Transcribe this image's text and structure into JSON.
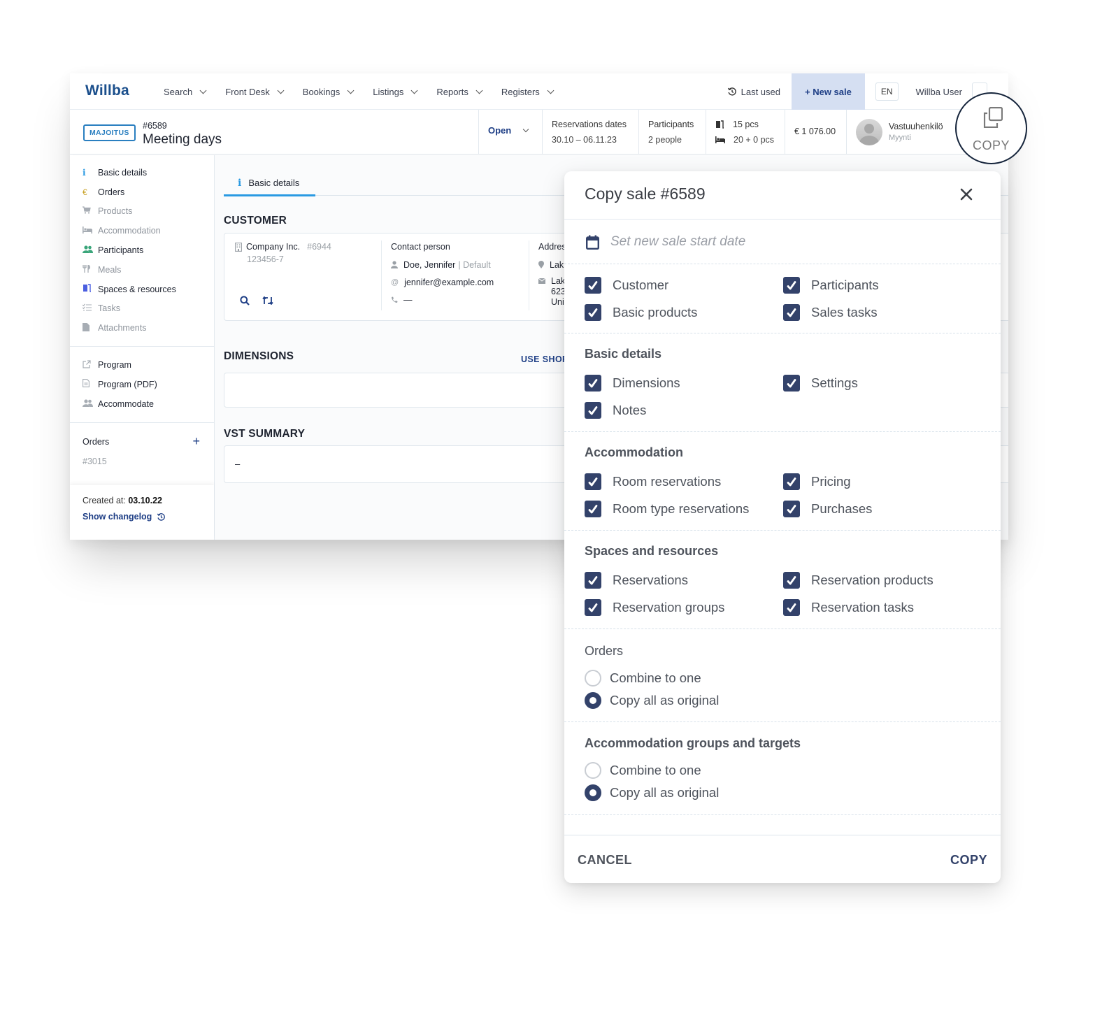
{
  "nav": {
    "logo": "Willba",
    "menu": [
      {
        "label": "Search"
      },
      {
        "label": "Front Desk"
      },
      {
        "label": "Bookings"
      },
      {
        "label": "Listings"
      },
      {
        "label": "Reports"
      },
      {
        "label": "Registers"
      }
    ],
    "last_used": "Last used",
    "new_sale": "+ New sale",
    "language": "EN",
    "user_name": "Willba User"
  },
  "sale": {
    "type_badge": "MAJOITUS",
    "id": "#6589",
    "title": "Meeting days",
    "status": "Open",
    "reservation_dates_label": "Reservations dates",
    "reservation_dates_value": "30.10 – 06.11.23",
    "participants_label": "Participants",
    "participants_value": "2 people",
    "spaces_count": "15 pcs",
    "beds_count": "20 + 0 pcs",
    "total": "€ 1 076.00",
    "responsible_name": "Vastuuhenkilö",
    "responsible_role": "Myynti"
  },
  "copy_callout": {
    "label": "COPY"
  },
  "sidebar": {
    "items": [
      {
        "label": "Basic details",
        "icon": "i",
        "state": "on",
        "color": "#2a9ae2"
      },
      {
        "label": "Orders",
        "icon": "€",
        "state": "on",
        "color": "#c9a227"
      },
      {
        "label": "Products",
        "icon": "cart",
        "state": "off",
        "color": "#a7adb4"
      },
      {
        "label": "Accommodation",
        "icon": "bed",
        "state": "off",
        "color": "#a7adb4"
      },
      {
        "label": "Participants",
        "icon": "people",
        "state": "on",
        "color": "#3aa57a"
      },
      {
        "label": "Meals",
        "icon": "cutlery",
        "state": "off",
        "color": "#a7adb4"
      },
      {
        "label": "Spaces & resources",
        "icon": "door",
        "state": "on",
        "color": "#4b5fe0"
      },
      {
        "label": "Tasks",
        "icon": "list",
        "state": "off",
        "color": "#a7adb4"
      },
      {
        "label": "Attachments",
        "icon": "file",
        "state": "off",
        "color": "#a7adb4"
      }
    ],
    "links": [
      {
        "label": "Program",
        "icon": "external"
      },
      {
        "label": "Program (PDF)",
        "icon": "doc"
      },
      {
        "label": "Accommodate",
        "icon": "people"
      }
    ],
    "orders_title": "Orders",
    "order_number": "#3015",
    "created_label": "Created at:",
    "created_value": "03.10.22",
    "changelog": "Show changelog"
  },
  "main": {
    "tab": "Basic details",
    "customer_title": "CUSTOMER",
    "company_name": "Company Inc.",
    "company_id": "#6944",
    "company_code": "123456-7",
    "contact_label": "Contact person",
    "contact_name": "Doe, Jennifer",
    "contact_tag": "| Default",
    "contact_email": "jennifer@example.com",
    "contact_phone": "—",
    "address_label": "Addres",
    "address_line1": "Lak",
    "address_post1": "Lak",
    "address_post2": "623",
    "address_post3": "Uni",
    "dimensions_title": "DIMENSIONS",
    "use_shortcut": "USE SHOR",
    "vst_title": "VST SUMMARY",
    "vst_value": "–"
  },
  "modal": {
    "title": "Copy sale #6589",
    "date_placeholder": "Set new sale start date",
    "general": [
      {
        "label": "Customer",
        "checked": true
      },
      {
        "label": "Participants",
        "checked": true
      },
      {
        "label": "Basic products",
        "checked": true
      },
      {
        "label": "Sales tasks",
        "checked": true
      }
    ],
    "basic_details": {
      "title": "Basic details",
      "items": [
        {
          "label": "Dimensions",
          "checked": true
        },
        {
          "label": "Settings",
          "checked": true
        },
        {
          "label": "Notes",
          "checked": true
        }
      ]
    },
    "accommodation": {
      "title": "Accommodation",
      "items": [
        {
          "label": "Room reservations",
          "checked": true
        },
        {
          "label": "Pricing",
          "checked": true
        },
        {
          "label": "Room type reservations",
          "checked": true
        },
        {
          "label": "Purchases",
          "checked": true
        }
      ]
    },
    "spaces": {
      "title": "Spaces and resources",
      "items": [
        {
          "label": "Reservations",
          "checked": true
        },
        {
          "label": "Reservation products",
          "checked": true
        },
        {
          "label": "Reservation groups",
          "checked": true
        },
        {
          "label": "Reservation tasks",
          "checked": true
        }
      ]
    },
    "orders": {
      "title": "Orders",
      "options": [
        {
          "label": "Combine to one",
          "selected": false
        },
        {
          "label": "Copy all as original",
          "selected": true
        }
      ]
    },
    "acc_groups": {
      "title": "Accommodation groups and targets",
      "options": [
        {
          "label": "Combine to one",
          "selected": false
        },
        {
          "label": "Copy all as original",
          "selected": true
        }
      ]
    },
    "cancel": "CANCEL",
    "copy": "COPY"
  }
}
